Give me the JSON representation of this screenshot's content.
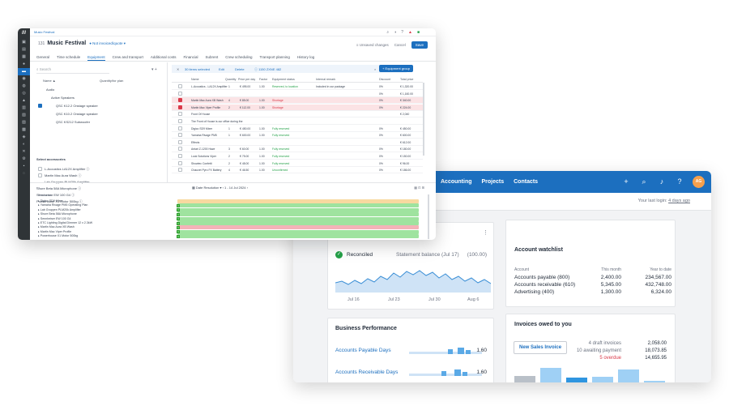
{
  "accounting": {
    "nav": [
      "Accounting",
      "Projects",
      "Contacts"
    ],
    "icons": [
      "plus-icon",
      "search-icon",
      "bell-icon",
      "help-icon"
    ],
    "avatar_initials": "AG",
    "last_login_label": "Your last login:",
    "last_login_value": "4 days ago",
    "bank_card": {
      "status": "Reconciled",
      "statement_label": "Statement balance (Jul 17)",
      "statement_value": "(100.00)",
      "axis": [
        "Jul 16",
        "Jul 23",
        "Jul 30",
        "Aug 6"
      ]
    },
    "watchlist": {
      "title": "Account watchlist",
      "col_account": "Account",
      "col_month": "This month",
      "col_ytd": "Year to date",
      "rows": [
        {
          "account": "Accounts payable (800)",
          "month": "2,400.00",
          "ytd": "234,567.00"
        },
        {
          "account": "Accounts receivable (610)",
          "month": "5,345.00",
          "ytd": "432,748.00"
        },
        {
          "account": "Advertising (400)",
          "month": "1,300.00",
          "ytd": "6,324.00"
        }
      ]
    },
    "performance": {
      "title": "Business Performance",
      "rows": [
        {
          "label": "Accounts Payable Days",
          "value": "1.60"
        },
        {
          "label": "Accounts Receivable Days",
          "value": "1.60"
        }
      ]
    },
    "invoices": {
      "title": "Invoices owed to you",
      "button": "New Sales Invoice",
      "stats": [
        {
          "label": "4 draft invoices",
          "value": "2,058.00",
          "color": "#6b7280"
        },
        {
          "label": "10 awaiting payment",
          "value": "18,073.85",
          "color": "#6b7280"
        },
        {
          "label": "5 overdue",
          "value": "14,655.95",
          "color": "#d93a4a"
        }
      ]
    }
  },
  "festival": {
    "logo": "///",
    "crumb": "Music Festival",
    "title_prefix": "131",
    "title": "Music Festival",
    "status": "● Not invoiced/quote ▾",
    "actions": {
      "changes": "≡ Unsaved changes",
      "cancel": "Cancel",
      "save": "Save"
    },
    "tabs": [
      "General",
      "Time schedule",
      "Equipment",
      "Crew and transport",
      "Additional costs",
      "Financial",
      "Subrent",
      "Crew scheduling",
      "Transport planning",
      "History log"
    ],
    "active_tab": "Equipment",
    "search_placeholder": "Search",
    "left_header": {
      "name": "Name ▲",
      "qty": "Quantity/for plan"
    },
    "left_items": [
      "Audio",
      "Active Speakers",
      "QSC K12.2 Onstage speaker",
      "QSC K10.2 Onstage speaker",
      "QSC KS212 Subwoofer"
    ],
    "selected_header": "Select accessories",
    "selected_items": [
      "L-Acoustics LA12X Amplifier ⓘ",
      "Martin Mac Aura Wash ⓘ",
      "Lab Gruppen PLM20k Amplifier",
      "Shure Beta 58A Microphone ⓘ",
      "Sennheiser EW 100 G4 ⓘ",
      "Powerhouse X1 Motor 500kg ⓘ"
    ],
    "toolbar": {
      "selected": "30 items selected",
      "edit": "Edit",
      "delete": "Delete",
      "totals": "ⓘ 1150 ZXNE 482",
      "add": "+ Equipment group"
    },
    "table_header": [
      "Name",
      "Quantity",
      "Price per day",
      "Factor",
      "Equipment status",
      "Internal remark",
      "Discount",
      "Total price"
    ],
    "rows": [
      {
        "name": "L-Acoustics - LA12X Amplifier",
        "qty": "1",
        "price": "€ 495.00",
        "factor": "1.00",
        "status": "Reserved, to location",
        "status_class": "g",
        "remark": "Included in our package",
        "disc": "0%",
        "total": "€ 1,320.00",
        "red": false
      },
      {
        "name": "",
        "qty": "",
        "price": "",
        "factor": "",
        "status": "",
        "status_class": "",
        "remark": "",
        "disc": "0%",
        "total": "€ 1,160.00",
        "red": false
      },
      {
        "name": "Martin Mac Aura XB Wash",
        "qty": "4",
        "price": "€ 85.00",
        "factor": "1.00",
        "status": "Shortage",
        "status_class": "r",
        "remark": "",
        "disc": "0%",
        "total": "€ 340.00",
        "red": true
      },
      {
        "name": "Martin Mac Viper Profile",
        "qty": "2",
        "price": "€ 112.00",
        "factor": "1.00",
        "status": "Shortage",
        "status_class": "r",
        "remark": "",
        "disc": "0%",
        "total": "€ 224.00",
        "red": true
      },
      {
        "name": "Front Of House",
        "qty": "",
        "price": "",
        "factor": "",
        "status": "",
        "status_class": "",
        "remark": "",
        "disc": "",
        "total": "€ 2,040",
        "red": false
      },
      {
        "name": "The Front of House is our office during the",
        "qty": "",
        "price": "",
        "factor": "",
        "status": "",
        "status_class": "",
        "remark": "",
        "disc": "",
        "total": "",
        "red": false
      },
      {
        "name": "Digico SD9 Mixer",
        "qty": "1",
        "price": "€ 450.00",
        "factor": "1.00",
        "status": "Fully reserved",
        "status_class": "g",
        "remark": "",
        "disc": "0%",
        "total": "€ 450.00",
        "red": false
      },
      {
        "name": "Yamaha Rivage PM5",
        "qty": "1",
        "price": "€ 600.00",
        "factor": "1.00",
        "status": "Fully reserved",
        "status_class": "g",
        "remark": "",
        "disc": "0%",
        "total": "€ 600.00",
        "red": false
      },
      {
        "name": "Effects",
        "qty": "",
        "price": "",
        "factor": "",
        "status": "",
        "status_class": "",
        "remark": "",
        "disc": "",
        "total": "€ 612.00",
        "red": false
      },
      {
        "name": "Antari Z-1200 Haze",
        "qty": "3",
        "price": "€ 60.00",
        "factor": "1.00",
        "status": "Fully reserved",
        "status_class": "g",
        "remark": "",
        "disc": "0%",
        "total": "€ 180.00",
        "red": false
      },
      {
        "name": "Look Solutions Viper",
        "qty": "2",
        "price": "€ 75.00",
        "factor": "1.00",
        "status": "Fully reserved",
        "status_class": "g",
        "remark": "",
        "disc": "0%",
        "total": "€ 150.00",
        "red": false
      },
      {
        "name": "Showtec Confetti",
        "qty": "2",
        "price": "€ 48.00",
        "factor": "1.00",
        "status": "Fully reserved",
        "status_class": "g",
        "remark": "",
        "disc": "0%",
        "total": "€ 96.00",
        "red": false
      },
      {
        "name": "Chauvet Pyro FX Battery",
        "qty": "4",
        "price": "€ 46.50",
        "factor": "1.00",
        "status": "Unconfirmed",
        "status_class": "g",
        "remark": "",
        "disc": "0%",
        "total": "€ 186.00",
        "red": false
      }
    ],
    "gantt": {
      "toolbar": "▦ Date Resolution ▾   ‹   1 - 14 Jul 2024   ›",
      "resources_label": "Resources",
      "lines": [
        {
          "label": "▸ Digico SD9 Mixer",
          "cls": "y"
        },
        {
          "label": "▸ Yamaha Rivage PM5 Operating Plan",
          "cls": "g"
        },
        {
          "label": "▸ Lab Gruppen PLM20k Amplifier",
          "cls": "g"
        },
        {
          "label": "▸ Shure Beta 58A Microphone",
          "cls": "g"
        },
        {
          "label": "▸ Sennheiser EW 100 G4",
          "cls": "g"
        },
        {
          "label": "▸ ETC Lighting Digital Dimmer 12 x 2.3kW",
          "cls": "g"
        },
        {
          "label": "▸ Martin Mac Aura XB Wash",
          "cls": "r"
        },
        {
          "label": "▸ Martin Mac Viper Profile",
          "cls": "g"
        },
        {
          "label": "▸ Powerhouse X1 Motor 500kg",
          "cls": "g"
        }
      ]
    }
  }
}
